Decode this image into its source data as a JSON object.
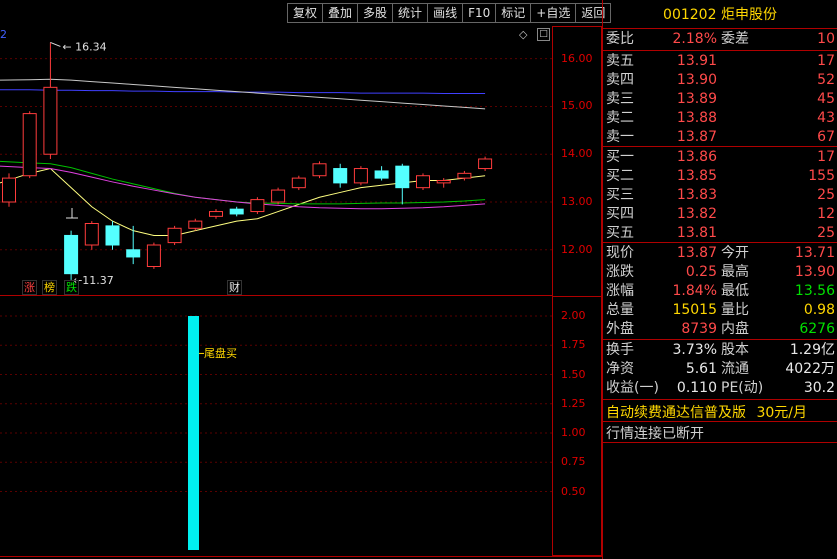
{
  "toolbar": [
    "复权",
    "叠加",
    "多股",
    "统计",
    "画线",
    "F10",
    "标记",
    "+自选",
    "返回"
  ],
  "main_chart": {
    "y_ticks": [
      "16.00",
      "15.00",
      "14.00",
      "13.00",
      "12.00"
    ],
    "high_label": "16.34",
    "low_label": "11.37",
    "period_label": "2",
    "badges": [
      {
        "text": "涨",
        "color": "#ff4040"
      },
      {
        "text": "榜",
        "color": "#ffd700"
      },
      {
        "text": "跌",
        "color": "#00e000"
      },
      {
        "text": "财",
        "color": "#e8e8e8"
      }
    ]
  },
  "sub_chart": {
    "y_ticks": [
      "2.00",
      "1.75",
      "1.50",
      "1.25",
      "1.00",
      "0.75",
      "0.50"
    ],
    "signal_label": "尾盘买",
    "signal_value": 2.0
  },
  "chart_data": {
    "type": "candlestick",
    "ylim": [
      11.2,
      16.6
    ],
    "candles": [
      {
        "o": 13.0,
        "c": 13.5,
        "h": 13.6,
        "l": 12.9
      },
      {
        "o": 13.55,
        "c": 14.85,
        "h": 14.9,
        "l": 13.5
      },
      {
        "o": 14.0,
        "c": 15.4,
        "h": 16.34,
        "l": 13.9
      },
      {
        "o": 12.3,
        "c": 11.5,
        "h": 12.4,
        "l": 11.37
      },
      {
        "o": 12.1,
        "c": 12.55,
        "h": 12.6,
        "l": 12.0
      },
      {
        "o": 12.5,
        "c": 12.1,
        "h": 12.6,
        "l": 12.0
      },
      {
        "o": 12.0,
        "c": 11.85,
        "h": 12.5,
        "l": 11.7
      },
      {
        "o": 11.65,
        "c": 12.1,
        "h": 12.15,
        "l": 11.6
      },
      {
        "o": 12.15,
        "c": 12.45,
        "h": 12.5,
        "l": 12.1
      },
      {
        "o": 12.45,
        "c": 12.6,
        "h": 12.65,
        "l": 12.4
      },
      {
        "o": 12.7,
        "c": 12.8,
        "h": 12.85,
        "l": 12.65
      },
      {
        "o": 12.85,
        "c": 12.75,
        "h": 12.9,
        "l": 12.7
      },
      {
        "o": 12.8,
        "c": 13.05,
        "h": 13.1,
        "l": 12.75
      },
      {
        "o": 13.0,
        "c": 13.25,
        "h": 13.3,
        "l": 12.95
      },
      {
        "o": 13.3,
        "c": 13.5,
        "h": 13.55,
        "l": 13.25
      },
      {
        "o": 13.55,
        "c": 13.8,
        "h": 13.85,
        "l": 13.5
      },
      {
        "o": 13.7,
        "c": 13.4,
        "h": 13.8,
        "l": 13.3
      },
      {
        "o": 13.4,
        "c": 13.7,
        "h": 13.75,
        "l": 13.35
      },
      {
        "o": 13.65,
        "c": 13.5,
        "h": 13.75,
        "l": 13.45
      },
      {
        "o": 13.75,
        "c": 13.3,
        "h": 13.8,
        "l": 12.95
      },
      {
        "o": 13.3,
        "c": 13.55,
        "h": 13.6,
        "l": 13.25
      },
      {
        "o": 13.4,
        "c": 13.45,
        "h": 13.5,
        "l": 13.3
      },
      {
        "o": 13.5,
        "c": 13.6,
        "h": 13.65,
        "l": 13.45
      },
      {
        "o": 13.7,
        "c": 13.9,
        "h": 13.95,
        "l": 13.65
      }
    ],
    "ma_lines": [
      {
        "color": "#4040ff",
        "values": [
          15.35,
          15.35,
          15.34,
          15.34,
          15.33,
          15.33,
          15.32,
          15.32,
          15.31,
          15.31,
          15.31,
          15.3,
          15.3,
          15.3,
          15.29,
          15.29,
          15.29,
          15.28,
          15.28,
          15.28,
          15.28,
          15.27,
          15.27,
          15.27
        ]
      },
      {
        "color": "#c8c8c8",
        "values": [
          15.55,
          15.56,
          15.57,
          15.55,
          15.52,
          15.49,
          15.46,
          15.43,
          15.4,
          15.37,
          15.34,
          15.31,
          15.28,
          15.25,
          15.22,
          15.19,
          15.16,
          15.13,
          15.1,
          15.07,
          15.04,
          15.01,
          14.98,
          14.95
        ]
      },
      {
        "color": "#ffff80",
        "values": [
          13.4,
          13.6,
          13.7,
          13.3,
          12.9,
          12.6,
          12.4,
          12.3,
          12.3,
          12.4,
          12.5,
          12.6,
          12.65,
          12.8,
          12.95,
          13.1,
          13.2,
          13.3,
          13.35,
          13.4,
          13.45,
          13.45,
          13.5,
          13.55
        ]
      },
      {
        "color": "#00c000",
        "values": [
          13.85,
          13.82,
          13.8,
          13.72,
          13.6,
          13.48,
          13.38,
          13.28,
          13.18,
          13.1,
          13.05,
          13.0,
          12.98,
          12.97,
          12.96,
          12.96,
          12.96,
          12.97,
          12.98,
          12.98,
          12.99,
          13.0,
          13.02,
          13.05
        ]
      },
      {
        "color": "#e040e0",
        "values": [
          13.75,
          13.72,
          13.7,
          13.62,
          13.52,
          13.42,
          13.33,
          13.25,
          13.17,
          13.1,
          13.05,
          13.0,
          12.96,
          12.93,
          12.9,
          12.88,
          12.87,
          12.86,
          12.86,
          12.87,
          12.88,
          12.9,
          12.93,
          12.96
        ]
      }
    ]
  },
  "quote": {
    "code": "001202",
    "name": "炬申股份",
    "weibi": {
      "label": "委比",
      "value": "2.18%",
      "label2": "委差",
      "value2": "10"
    },
    "sell": [
      {
        "label": "卖五",
        "price": "13.91",
        "vol": "17"
      },
      {
        "label": "卖四",
        "price": "13.90",
        "vol": "52"
      },
      {
        "label": "卖三",
        "price": "13.89",
        "vol": "45"
      },
      {
        "label": "卖二",
        "price": "13.88",
        "vol": "43"
      },
      {
        "label": "卖一",
        "price": "13.87",
        "vol": "67"
      }
    ],
    "buy": [
      {
        "label": "买一",
        "price": "13.86",
        "vol": "17"
      },
      {
        "label": "买二",
        "price": "13.85",
        "vol": "155"
      },
      {
        "label": "买三",
        "price": "13.83",
        "vol": "25"
      },
      {
        "label": "买四",
        "price": "13.82",
        "vol": "12"
      },
      {
        "label": "买五",
        "price": "13.81",
        "vol": "25"
      }
    ],
    "stats1": [
      {
        "l1": "现价",
        "v1": "13.87",
        "c1": "red",
        "l2": "今开",
        "v2": "13.71",
        "c2": "red"
      },
      {
        "l1": "涨跌",
        "v1": "0.25",
        "c1": "red",
        "l2": "最高",
        "v2": "13.90",
        "c2": "red"
      },
      {
        "l1": "涨幅",
        "v1": "1.84%",
        "c1": "red",
        "l2": "最低",
        "v2": "13.56",
        "c2": "green"
      },
      {
        "l1": "总量",
        "v1": "15015",
        "c1": "yellow",
        "l2": "量比",
        "v2": "0.98",
        "c2": "yellow"
      },
      {
        "l1": "外盘",
        "v1": "8739",
        "c1": "red",
        "l2": "内盘",
        "v2": "6276",
        "c2": "green"
      }
    ],
    "stats2": [
      {
        "l1": "换手",
        "v1": "3.73%",
        "l2": "股本",
        "v2": "1.29亿"
      },
      {
        "l1": "净资",
        "v1": "5.61",
        "l2": "流通",
        "v2": "4022万"
      },
      {
        "l1": "收益(一)",
        "v1": "0.110",
        "l2": "PE(动)",
        "v2": "30.2"
      }
    ],
    "promo": "自动续费通达信普及版",
    "promo_price": "30元/月",
    "connection": "行情连接已断开"
  }
}
